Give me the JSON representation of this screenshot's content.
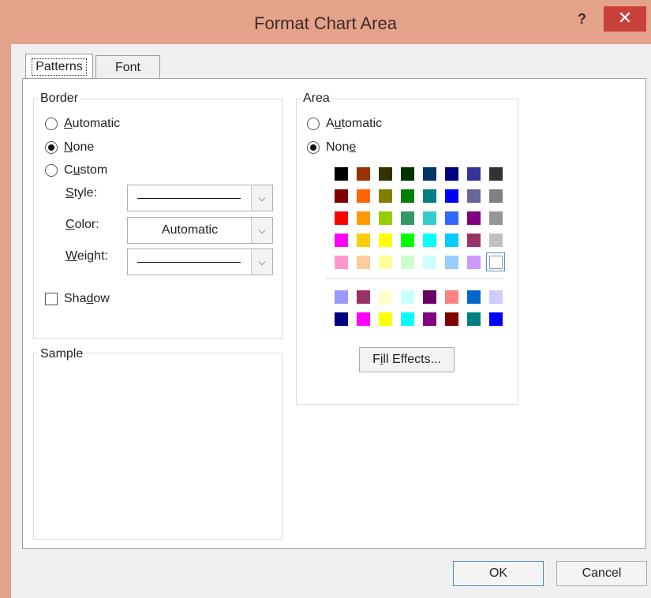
{
  "window": {
    "title": "Format Chart Area",
    "help_label": "?",
    "close_label": "✕"
  },
  "tabs": [
    {
      "label": "Patterns",
      "active": true
    },
    {
      "label": "Font",
      "active": false
    }
  ],
  "border": {
    "group_label": "Border",
    "options": [
      {
        "pre": "",
        "u": "A",
        "post": "utomatic",
        "selected": false
      },
      {
        "pre": "",
        "u": "N",
        "post": "one",
        "selected": true
      },
      {
        "pre": "C",
        "u": "u",
        "post": "stom",
        "selected": false
      }
    ],
    "style_label": {
      "pre": "",
      "u": "S",
      "post": "tyle:"
    },
    "color_label": {
      "pre": "",
      "u": "C",
      "post": "olor:"
    },
    "weight_label": {
      "pre": "",
      "u": "W",
      "post": "eight:"
    },
    "color_value": "Automatic",
    "shadow_label": {
      "pre": "Sha",
      "u": "d",
      "post": "ow"
    },
    "shadow_checked": false
  },
  "sample": {
    "group_label": "Sample"
  },
  "area": {
    "group_label": "Area",
    "options": [
      {
        "pre": "A",
        "u": "u",
        "post": "tomatic",
        "selected": false
      },
      {
        "pre": "Non",
        "u": "e",
        "post": "",
        "selected": true
      }
    ],
    "palette_main": [
      [
        "#000000",
        "#993300",
        "#333300",
        "#003300",
        "#003366",
        "#000080",
        "#333399",
        "#333333"
      ],
      [
        "#800000",
        "#FF6600",
        "#808000",
        "#008000",
        "#008080",
        "#0000FF",
        "#666699",
        "#808080"
      ],
      [
        "#FF0000",
        "#FF9900",
        "#99CC00",
        "#339966",
        "#33CCCC",
        "#3366FF",
        "#800080",
        "#969696"
      ],
      [
        "#FF00FF",
        "#FFCC00",
        "#FFFF00",
        "#00FF00",
        "#00FFFF",
        "#00CCFF",
        "#993366",
        "#C0C0C0"
      ],
      [
        "#FF99CC",
        "#FFCC99",
        "#FFFF99",
        "#CCFFCC",
        "#CCFFFF",
        "#99CCFF",
        "#CC99FF",
        "#FFFFFF"
      ]
    ],
    "palette_extra": [
      [
        "#9999FF",
        "#993366",
        "#FFFFCC",
        "#CCFFFF",
        "#660066",
        "#FF8080",
        "#0066CC",
        "#CCCCFF"
      ],
      [
        "#000080",
        "#FF00FF",
        "#FFFF00",
        "#00FFFF",
        "#800080",
        "#800000",
        "#008080",
        "#0000FF"
      ]
    ],
    "selected_swatch": "#FFFFFF",
    "fill_effects_label": {
      "pre": "F",
      "u": "i",
      "post": "ll Effects..."
    }
  },
  "footer": {
    "ok_label": "OK",
    "cancel_label": "Cancel"
  }
}
